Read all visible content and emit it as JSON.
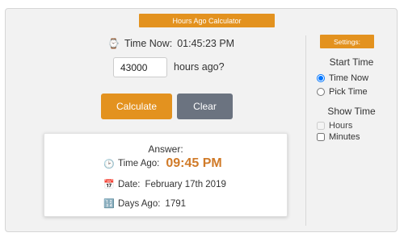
{
  "header": {
    "title": "Hours Ago Calculator"
  },
  "now": {
    "icon": "⌚",
    "label": "Time Now:",
    "value": "01:45:23 PM"
  },
  "input": {
    "value": "43000",
    "suffix": "hours ago?"
  },
  "buttons": {
    "calculate": "Calculate",
    "clear": "Clear"
  },
  "answer": {
    "title": "Answer:",
    "time_ago": {
      "icon": "🕑",
      "label": "Time Ago:",
      "value": "09:45 PM"
    },
    "date": {
      "icon": "📅",
      "label": "Date:",
      "value": "February 17th 2019"
    },
    "days_ago": {
      "icon": "🔢",
      "label": "Days Ago:",
      "value": "1791"
    }
  },
  "settings": {
    "title": "Settings:",
    "start_time": {
      "label": "Start Time",
      "options": [
        {
          "label": "Time Now",
          "checked": true
        },
        {
          "label": "Pick Time",
          "checked": false
        }
      ]
    },
    "show_time": {
      "label": "Show Time",
      "options": [
        {
          "label": "Hours",
          "checked": false,
          "disabled": true
        },
        {
          "label": "Minutes",
          "checked": false,
          "disabled": false
        }
      ]
    }
  },
  "colors": {
    "accent": "#e3921f",
    "clear_button": "#6b7380",
    "answer_highlight": "#d07a28"
  }
}
